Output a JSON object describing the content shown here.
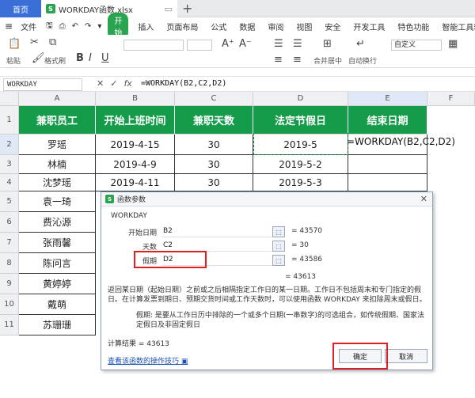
{
  "tabs": {
    "home": "首页",
    "file": "WORKDAY函数.xlsx"
  },
  "menu": [
    "文件",
    "开始",
    "插入",
    "页面布局",
    "公式",
    "数据",
    "审阅",
    "视图",
    "安全",
    "开发工具",
    "特色功能",
    "智能工具箱"
  ],
  "menu_file": "文件",
  "ribbon": {
    "paste": "粘贴",
    "format_painter": "格式刷",
    "merge_center": "合并居中",
    "auto_wrap": "自动换行",
    "number_format": "自定义"
  },
  "formula_bar": {
    "name_box": "WORKDAY",
    "formula": "=WORKDAY(B2,C2,D2)"
  },
  "columns": [
    "A",
    "B",
    "C",
    "D",
    "E",
    "F"
  ],
  "rows": [
    "1",
    "2",
    "3",
    "4",
    "5",
    "6",
    "7",
    "8",
    "9",
    "10",
    "11"
  ],
  "table": {
    "headers": [
      "兼职员工",
      "开始上班时间",
      "兼职天数",
      "法定节假日",
      "结束日期"
    ],
    "rows": [
      [
        "罗瑶",
        "2019-4-15",
        "30",
        "2019-5",
        "=WORKDAY(B2,C2,D2)"
      ],
      [
        "林楠",
        "2019-4-9",
        "30",
        "2019-5-2",
        ""
      ],
      [
        "沈梦瑶",
        "2019-4-11",
        "30",
        "2019-5-3",
        ""
      ],
      [
        "袁一琦",
        "",
        "",
        "",
        ""
      ],
      [
        "费沁源",
        "",
        "",
        "",
        ""
      ],
      [
        "张雨馨",
        "",
        "",
        "",
        ""
      ],
      [
        "陈问言",
        "",
        "",
        "",
        ""
      ],
      [
        "黄婷婷",
        "",
        "",
        "",
        ""
      ],
      [
        "戴萌",
        "",
        "",
        "",
        ""
      ],
      [
        "苏珊珊",
        "",
        "",
        "",
        ""
      ]
    ]
  },
  "dialog": {
    "title": "函数参数",
    "function_name": "WORKDAY",
    "args": [
      {
        "label": "开始日期",
        "value": "B2",
        "result": "= 43570"
      },
      {
        "label": "天数",
        "value": "C2",
        "result": "= 30"
      },
      {
        "label": "假期",
        "value": "D2",
        "result": "= 43586"
      }
    ],
    "result": "= 43613",
    "description": "返回某日期（起始日期）之前或之后相隔指定工作日的某一日期。工作日不包括周末和专门指定的假日。在计算发票到期日、预期交货时间或工作天数时，可以使用函数 WORKDAY 来扣除周末或假日。",
    "arg_help_label": "假期:",
    "arg_help": "是要从工作日历中排除的一个或多个日期(一串数字)的可选组合，如传统假期、国家法定假日及非固定假日",
    "calc_result": "计算结果 = 43613",
    "help_link": "查看该函数的操作技巧",
    "ok": "确定",
    "cancel": "取消"
  },
  "colors": {
    "header_green": "#159c4b",
    "accent_blue": "#3b6fd8",
    "highlight_red": "#e02020"
  }
}
